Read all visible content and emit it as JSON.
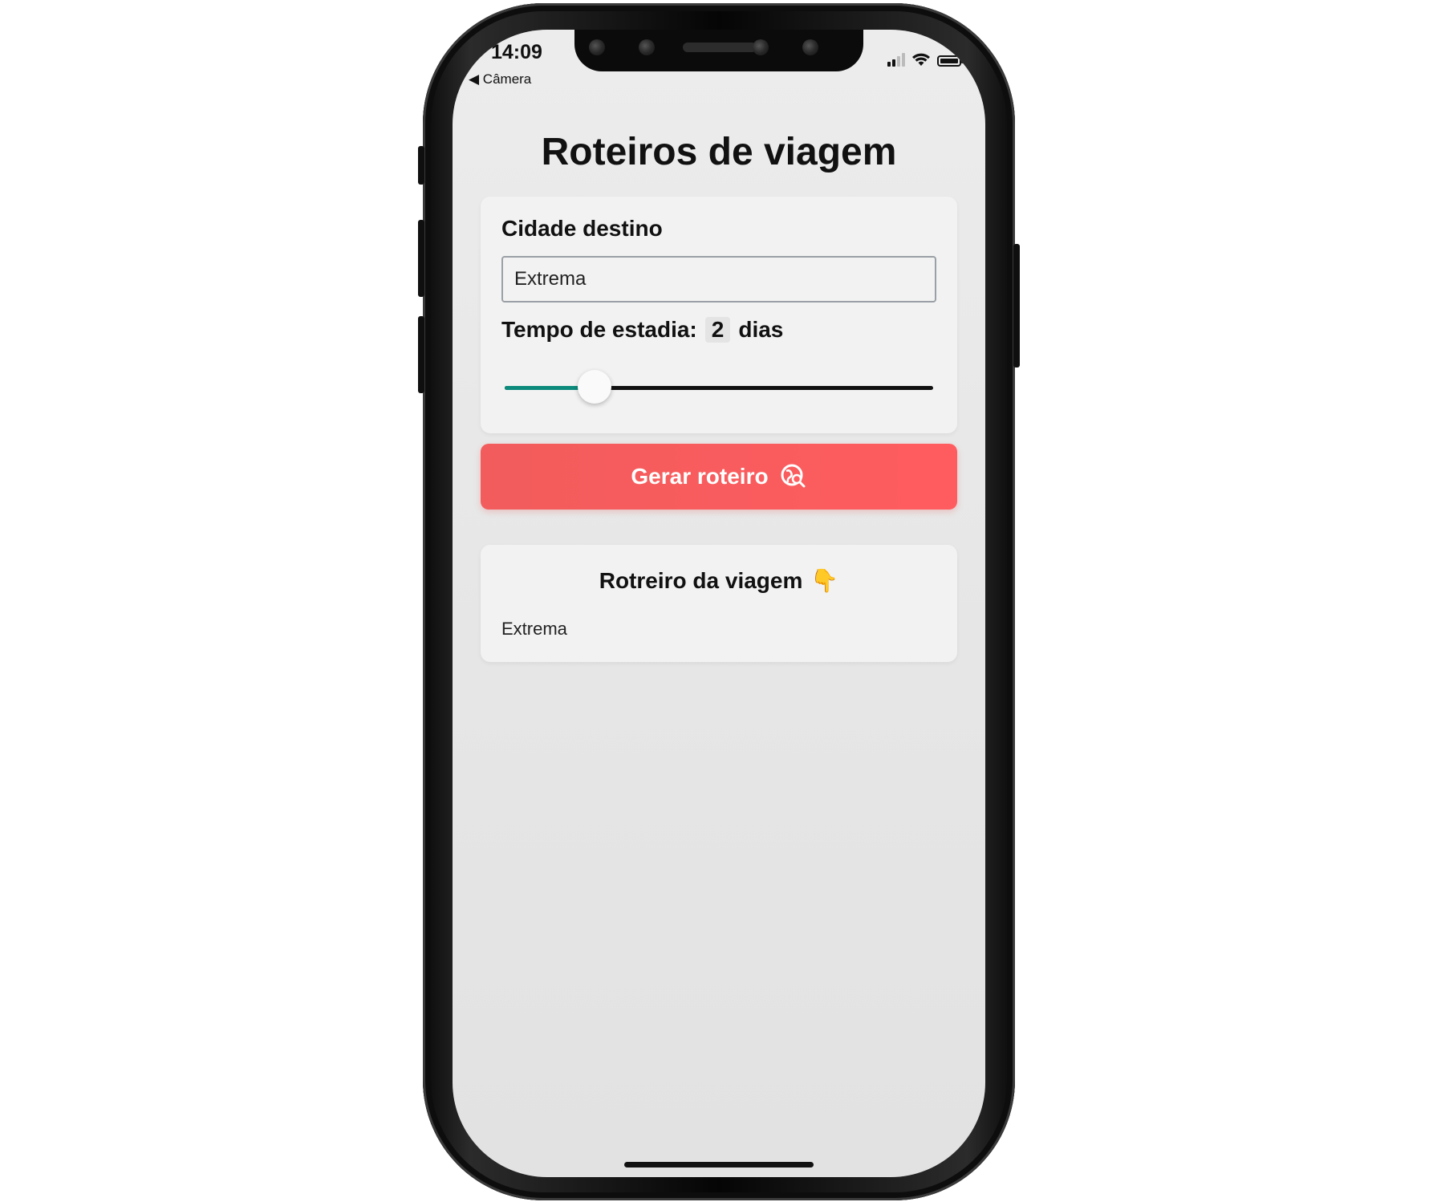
{
  "status_bar": {
    "time": "14:09",
    "back_label": "◀ Câmera"
  },
  "page": {
    "title": "Roteiros de viagem"
  },
  "form": {
    "city_label": "Cidade destino",
    "city_value": "Extrema",
    "stay_label": "Tempo de estadia:",
    "days_value": "2",
    "days_unit": "dias",
    "slider_fraction": 0.21
  },
  "button": {
    "label": "Gerar roteiro",
    "icon": "map-search-icon"
  },
  "result": {
    "title": "Rotreiro da viagem",
    "emoji": "👇",
    "text": "Extrema"
  },
  "colors": {
    "accent_button": "#ff5c5f",
    "slider_progress": "#0c8a7b"
  }
}
